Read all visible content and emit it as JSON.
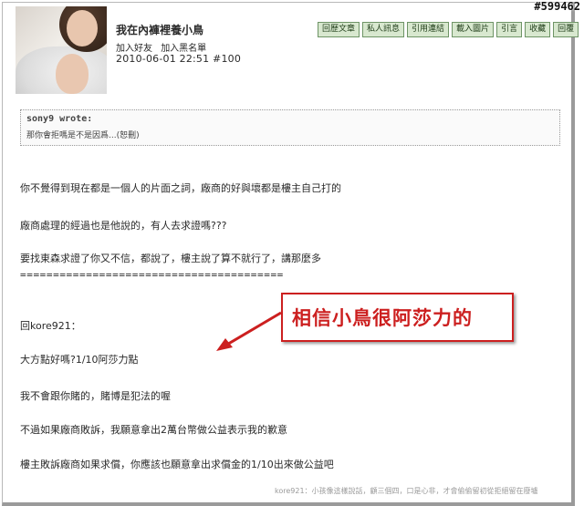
{
  "watermark": "#599462",
  "poster": {
    "name": "我在內褲裡養小鳥",
    "add_friend": "加入好友",
    "add_blacklist": "加入黑名單",
    "datetime": "2010-06-01 22:51",
    "post_number": "#100"
  },
  "actions": [
    "回歷文章",
    "私人訊息",
    "引用連結",
    "載入圖片",
    "引言",
    "收藏",
    "回覆"
  ],
  "quote": {
    "author": "sony9 wrote:",
    "text": "那你會拒嗎是不是因爲...(恕刪)"
  },
  "body": {
    "line1": "你不覺得到現在都是一個人的片面之詞，廠商的好與壞都是樓主自己打的",
    "line2": "廠商處理的經過也是他說的，有人去求證嗎???",
    "line3": "要找東森求證了你又不信，都說了，樓主說了算不就行了，講那麼多",
    "separator": "========================================",
    "line4": "回kore921：",
    "line5": "大方點好嗎?1/10阿莎力點",
    "line6": "我不會跟你賭的，賭博是犯法的喔",
    "line7": "不過如果廠商敗訴，我願意拿出2萬台幣做公益表示我的歉意",
    "line8": "樓主敗訴廠商如果求償，你應該也願意拿出求償金的1/10出來做公益吧"
  },
  "callout": "相信小鳥很阿莎力的",
  "signature": "kore921：小孩像這樣說話，顧三個四，口是心非，才會偷偷留初從拒絕留在廢壚",
  "colors": {
    "button_bg": "#d8e8cf",
    "button_border": "#6e9466",
    "callout_red": "#cc1f1f"
  },
  "icons": {
    "arrow": "red-arrow-icon"
  }
}
